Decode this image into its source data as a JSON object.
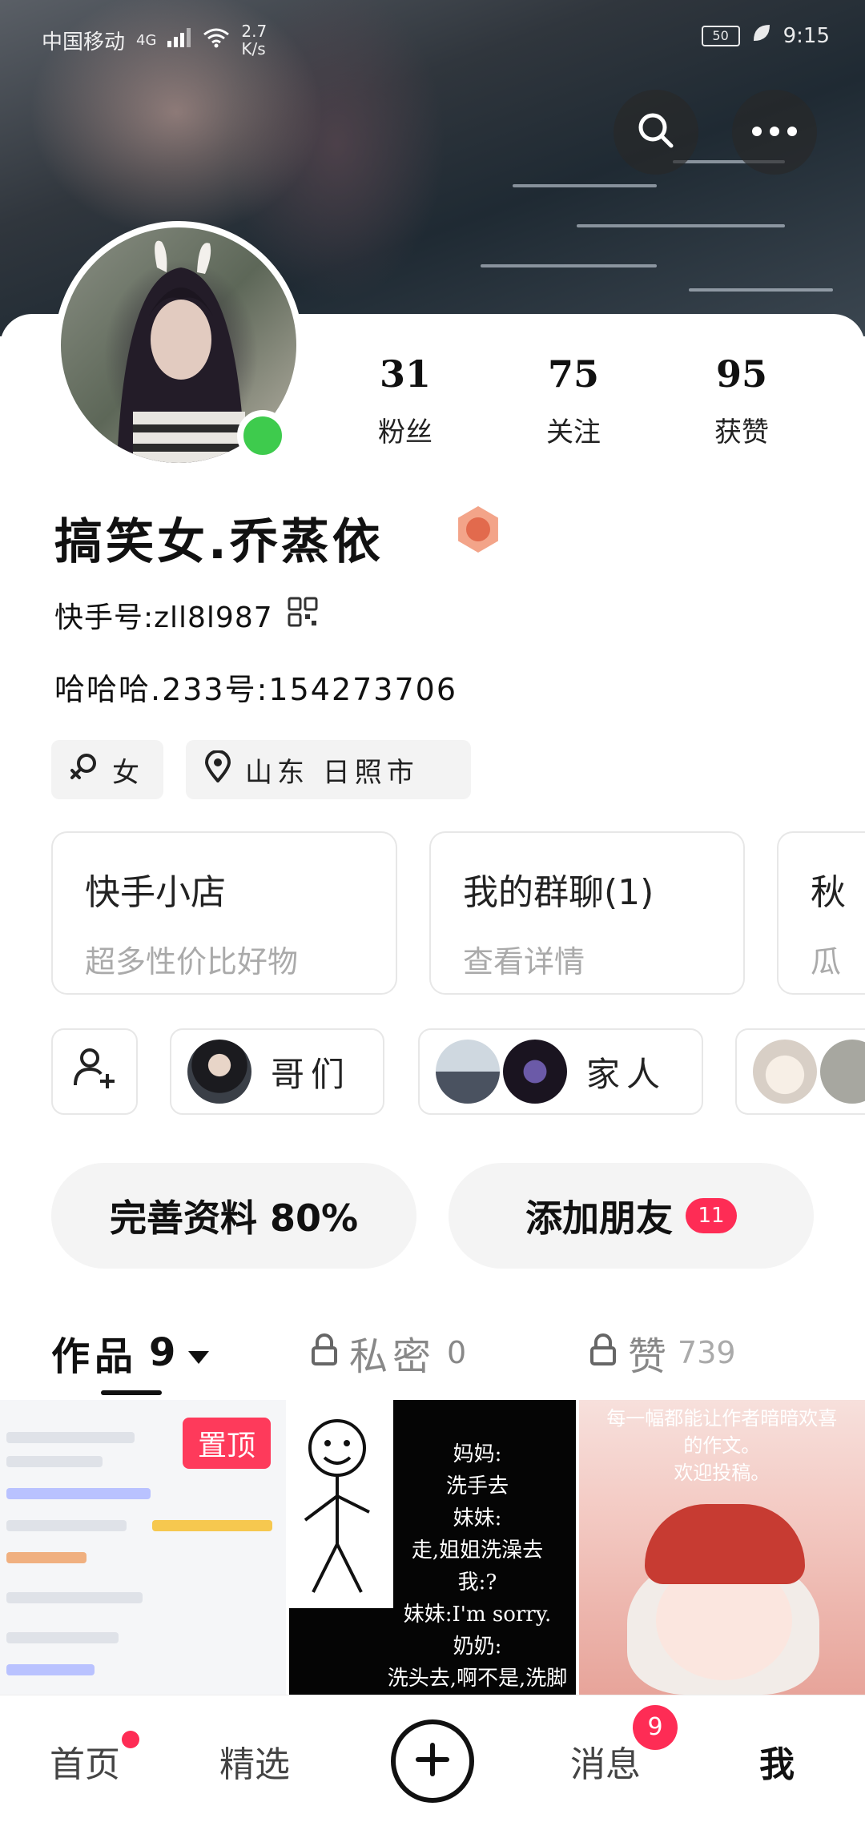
{
  "status_bar": {
    "carrier": "中国移动",
    "network": "4G",
    "speed_value": "2.7",
    "speed_unit": "K/s",
    "battery": "50",
    "time": "9:15"
  },
  "header": {
    "search_icon": "search-icon",
    "more_icon": "more-horizontal-icon"
  },
  "profile": {
    "stats": [
      {
        "value": "31",
        "label": "粉丝"
      },
      {
        "value": "75",
        "label": "关注"
      },
      {
        "value": "95",
        "label": "获赞"
      }
    ],
    "name": "搞笑女.乔蒸依",
    "ks_id": "快手号:zll8l987",
    "bio": "哈哈哈.233号:154273706",
    "tags": [
      {
        "icon": "gender-female-icon",
        "label": "女"
      },
      {
        "icon": "location-pin-icon",
        "label": "山东 日照市"
      }
    ]
  },
  "shop_cards": [
    {
      "title": "快手小店",
      "subtitle": "超多性价比好物"
    },
    {
      "title": "我的群聊(1)",
      "subtitle": "查看详情"
    },
    {
      "title": "秋",
      "subtitle": "瓜"
    }
  ],
  "groups": [
    {
      "label": "哥们"
    },
    {
      "label": "家人"
    }
  ],
  "actions": {
    "complete_profile": "完善资料 80%",
    "add_friend": "添加朋友",
    "add_friend_count": "11"
  },
  "tabs": [
    {
      "label": "作品",
      "count": "9"
    },
    {
      "label": "私密",
      "count": "0"
    },
    {
      "label": "赞",
      "count": "739"
    }
  ],
  "grid": {
    "pin_label": "置顶",
    "poem": "妈妈:\n洗手去\n妹妹:\n走,姐姐洗澡去\n我:?\n妹妹:I'm sorry.\n奶奶:\n洗头去,啊不是,洗脚去,\n对,洗澡去吧。",
    "cell3_text": "每一幅都能让作者暗暗欢喜\n的作文。\n欢迎投稿。"
  },
  "bottom_nav": {
    "home": "首页",
    "featured": "精选",
    "messages": "消息",
    "messages_badge": "9",
    "me": "我"
  },
  "colors": {
    "accent": "#fe2c55",
    "online": "#3ecb4d",
    "pin": "#fe3a5b"
  }
}
